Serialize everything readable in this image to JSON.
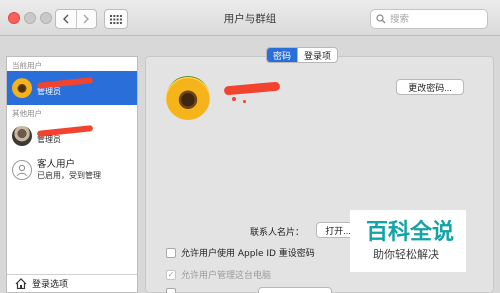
{
  "window": {
    "title": "用户与群组"
  },
  "search": {
    "placeholder": "搜索"
  },
  "sidebar": {
    "current_section": "当前用户",
    "current_user": {
      "role": "管理员"
    },
    "other_section": "其他用户",
    "other_user": {
      "role": "管理员"
    },
    "guest_user": {
      "name": "客人用户",
      "status": "已启用，受到管理"
    },
    "login_options": "登录选项"
  },
  "tabs": [
    {
      "label": "密码",
      "active": true
    },
    {
      "label": "登录项",
      "active": false
    }
  ],
  "main": {
    "change_password": "更改密码...",
    "contact_card_label": "联系人名片：",
    "open_button": "打开...",
    "check_apple_id": "允许用户使用 Apple ID 重设密码",
    "check_admin": "允许用户管理这台电脑"
  },
  "watermark": {
    "title": "百科全说",
    "subtitle": "助你轻松解决"
  },
  "colors": {
    "accent": "#2a6fd9",
    "redaction": "#f2432f",
    "watermark": "#11a3a7"
  }
}
